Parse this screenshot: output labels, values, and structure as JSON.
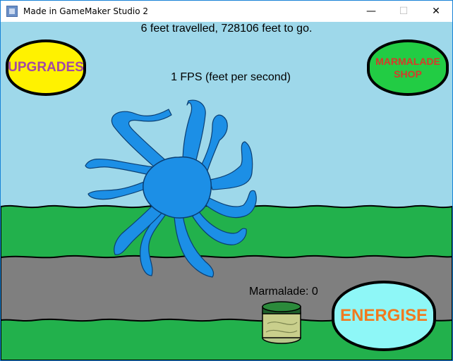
{
  "window": {
    "title": "Made in GameMaker Studio 2",
    "minimize_glyph": "—",
    "maximize_glyph": "☐",
    "close_glyph": "✕"
  },
  "hud": {
    "distance_text": "6 feet travelled, 728106 feet to go.",
    "fps_text": "1 FPS (feet per second)",
    "marmalade_text": "Marmalade: 0"
  },
  "buttons": {
    "upgrades_label": "UPGRADES",
    "shop_label_line1": "MARMALADE",
    "shop_label_line2": "SHOP",
    "energise_label": "ENERGISE"
  },
  "colors": {
    "sky": "#9ed8ea",
    "grass": "#22b14c",
    "road": "#7f7f7f",
    "creature": "#1c8fe6",
    "upgrades_fill": "#fff200",
    "upgrades_text": "#a349a4",
    "shop_fill": "#22cc44",
    "shop_text": "#d63a2a",
    "energise_fill": "#8ef7f7",
    "energise_text": "#f07a20"
  },
  "icons": {
    "creature": "blue-octopus-creature",
    "jar": "marmalade-jar"
  }
}
